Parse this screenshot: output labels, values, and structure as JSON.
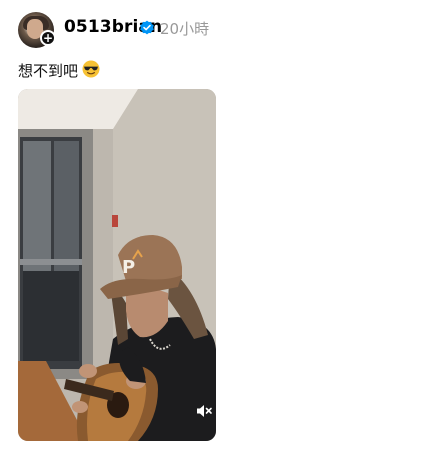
{
  "post": {
    "username": "0513brian",
    "timestamp": "20小時",
    "caption": "想不到吧",
    "caption_emoji": "face-with-sunglasses-emoji",
    "verified_color": "#0095f6",
    "media": {
      "type": "video",
      "mute_icon": "speaker-muted-icon",
      "cap_logo_text": "P"
    }
  }
}
